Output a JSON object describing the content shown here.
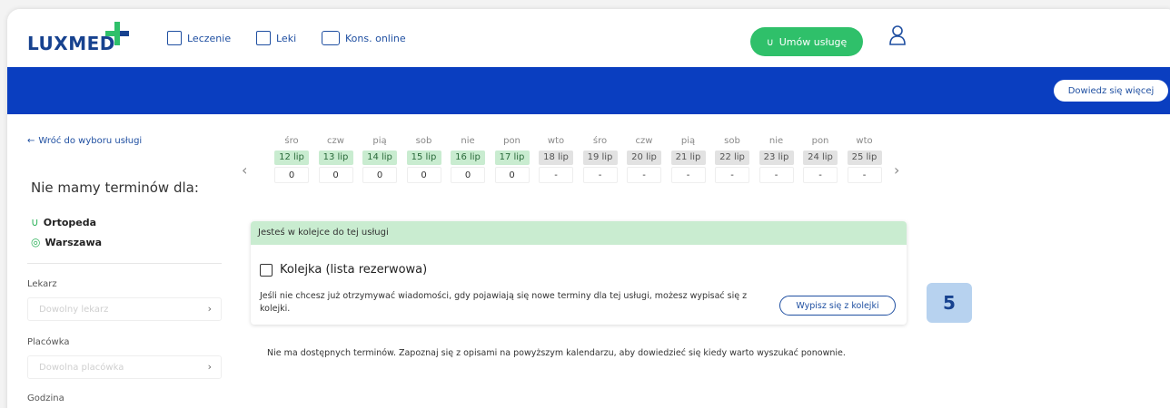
{
  "brand": {
    "logo": "LUXMED",
    "accent": "#2fc06a",
    "primary": "#0a3ec0"
  },
  "nav": {
    "items": [
      {
        "label": "Leczenie",
        "icon": "clipboard-icon"
      },
      {
        "label": "Leki",
        "icon": "pills-icon"
      },
      {
        "label": "Kons. online",
        "icon": "video-chat-icon"
      }
    ],
    "book_label": "Umów usługę",
    "user_icon": "user-icon"
  },
  "band": {
    "learn_more": "Dowiedz się więcej"
  },
  "sidebar": {
    "back": "Wróć do wyboru usługi",
    "heading": "Nie mamy terminów dla:",
    "service": "Ortopeda",
    "city": "Warszawa",
    "doctor_label": "Lekarz",
    "doctor_placeholder": "Dowolny lekarz",
    "clinic_label": "Placówka",
    "clinic_placeholder": "Dowolna placówka",
    "time_label": "Godzina"
  },
  "calendar": {
    "days": [
      {
        "dow": "śro",
        "date": "12 lip",
        "count": "0",
        "available": true
      },
      {
        "dow": "czw",
        "date": "13 lip",
        "count": "0",
        "available": true
      },
      {
        "dow": "pią",
        "date": "14 lip",
        "count": "0",
        "available": true
      },
      {
        "dow": "sob",
        "date": "15 lip",
        "count": "0",
        "available": true
      },
      {
        "dow": "nie",
        "date": "16 lip",
        "count": "0",
        "available": true
      },
      {
        "dow": "pon",
        "date": "17 lip",
        "count": "0",
        "available": true
      },
      {
        "dow": "wto",
        "date": "18 lip",
        "count": "-",
        "available": false
      },
      {
        "dow": "śro",
        "date": "19 lip",
        "count": "-",
        "available": false
      },
      {
        "dow": "czw",
        "date": "20 lip",
        "count": "-",
        "available": false
      },
      {
        "dow": "pią",
        "date": "21 lip",
        "count": "-",
        "available": false
      },
      {
        "dow": "sob",
        "date": "22 lip",
        "count": "-",
        "available": false
      },
      {
        "dow": "nie",
        "date": "23 lip",
        "count": "-",
        "available": false
      },
      {
        "dow": "pon",
        "date": "24 lip",
        "count": "-",
        "available": false
      },
      {
        "dow": "wto",
        "date": "25 lip",
        "count": "-",
        "available": false
      }
    ]
  },
  "queue": {
    "status": "Jesteś w kolejce do tej usługi",
    "title": "Kolejka (lista rezerwowa)",
    "text": "Jeśli nie chcesz już otrzymywać wiadomości, gdy pojawiają się nowe terminy dla tej usługi, możesz wypisać się z kolejki.",
    "unsubscribe": "Wypisz się z kolejki"
  },
  "step_badge": "5",
  "info": "Nie ma dostępnych terminów. Zapoznaj się z opisami na powyższym kalendarzu, aby dowiedzieć się kiedy warto wyszukać ponownie."
}
